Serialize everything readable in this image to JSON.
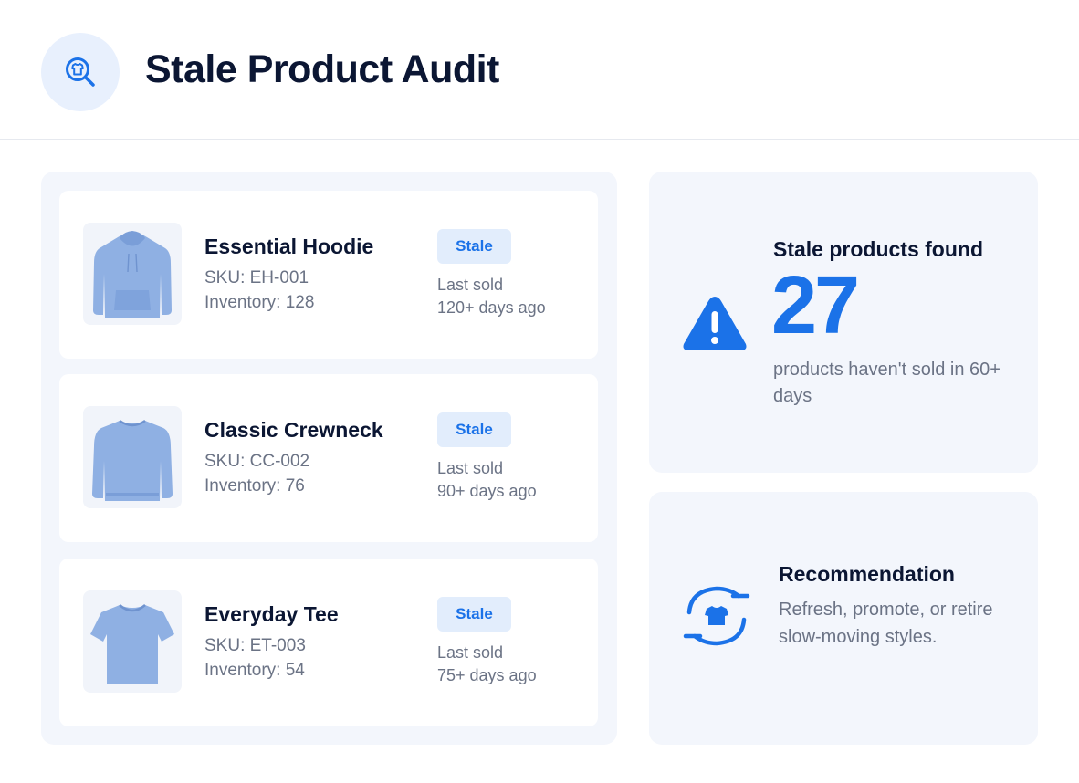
{
  "header": {
    "title": "Stale Product Audit",
    "icon": "search-shirt-icon"
  },
  "products": [
    {
      "name": "Essential Hoodie",
      "sku": "SKU: EH-001",
      "inventory": "Inventory: 128",
      "badge": "Stale",
      "last_label": "Last sold",
      "last_value": "120+ days ago",
      "image": "hoodie-image"
    },
    {
      "name": "Classic Crewneck",
      "sku": "SKU: CC-002",
      "inventory": "Inventory: 76",
      "badge": "Stale",
      "last_label": "Last sold",
      "last_value": "90+ days ago",
      "image": "crewneck-image"
    },
    {
      "name": "Everyday Tee",
      "sku": "SKU: ET-003",
      "inventory": "Inventory: 54",
      "badge": "Stale",
      "last_label": "Last sold",
      "last_value": "75+ days ago",
      "image": "tee-image"
    }
  ],
  "stats": {
    "title": "Stale products found",
    "count": "27",
    "caption": "products haven't sold in 60+ days",
    "icon": "warning-icon"
  },
  "recommendation": {
    "title": "Recommendation",
    "text": "Refresh, promote, or retire slow-moving styles.",
    "icon": "refresh-shirt-icon"
  },
  "colors": {
    "accent": "#1b72e8",
    "panel": "#f3f6fc",
    "badge_bg": "#e2edfc",
    "garment": "#8fb0e3"
  }
}
